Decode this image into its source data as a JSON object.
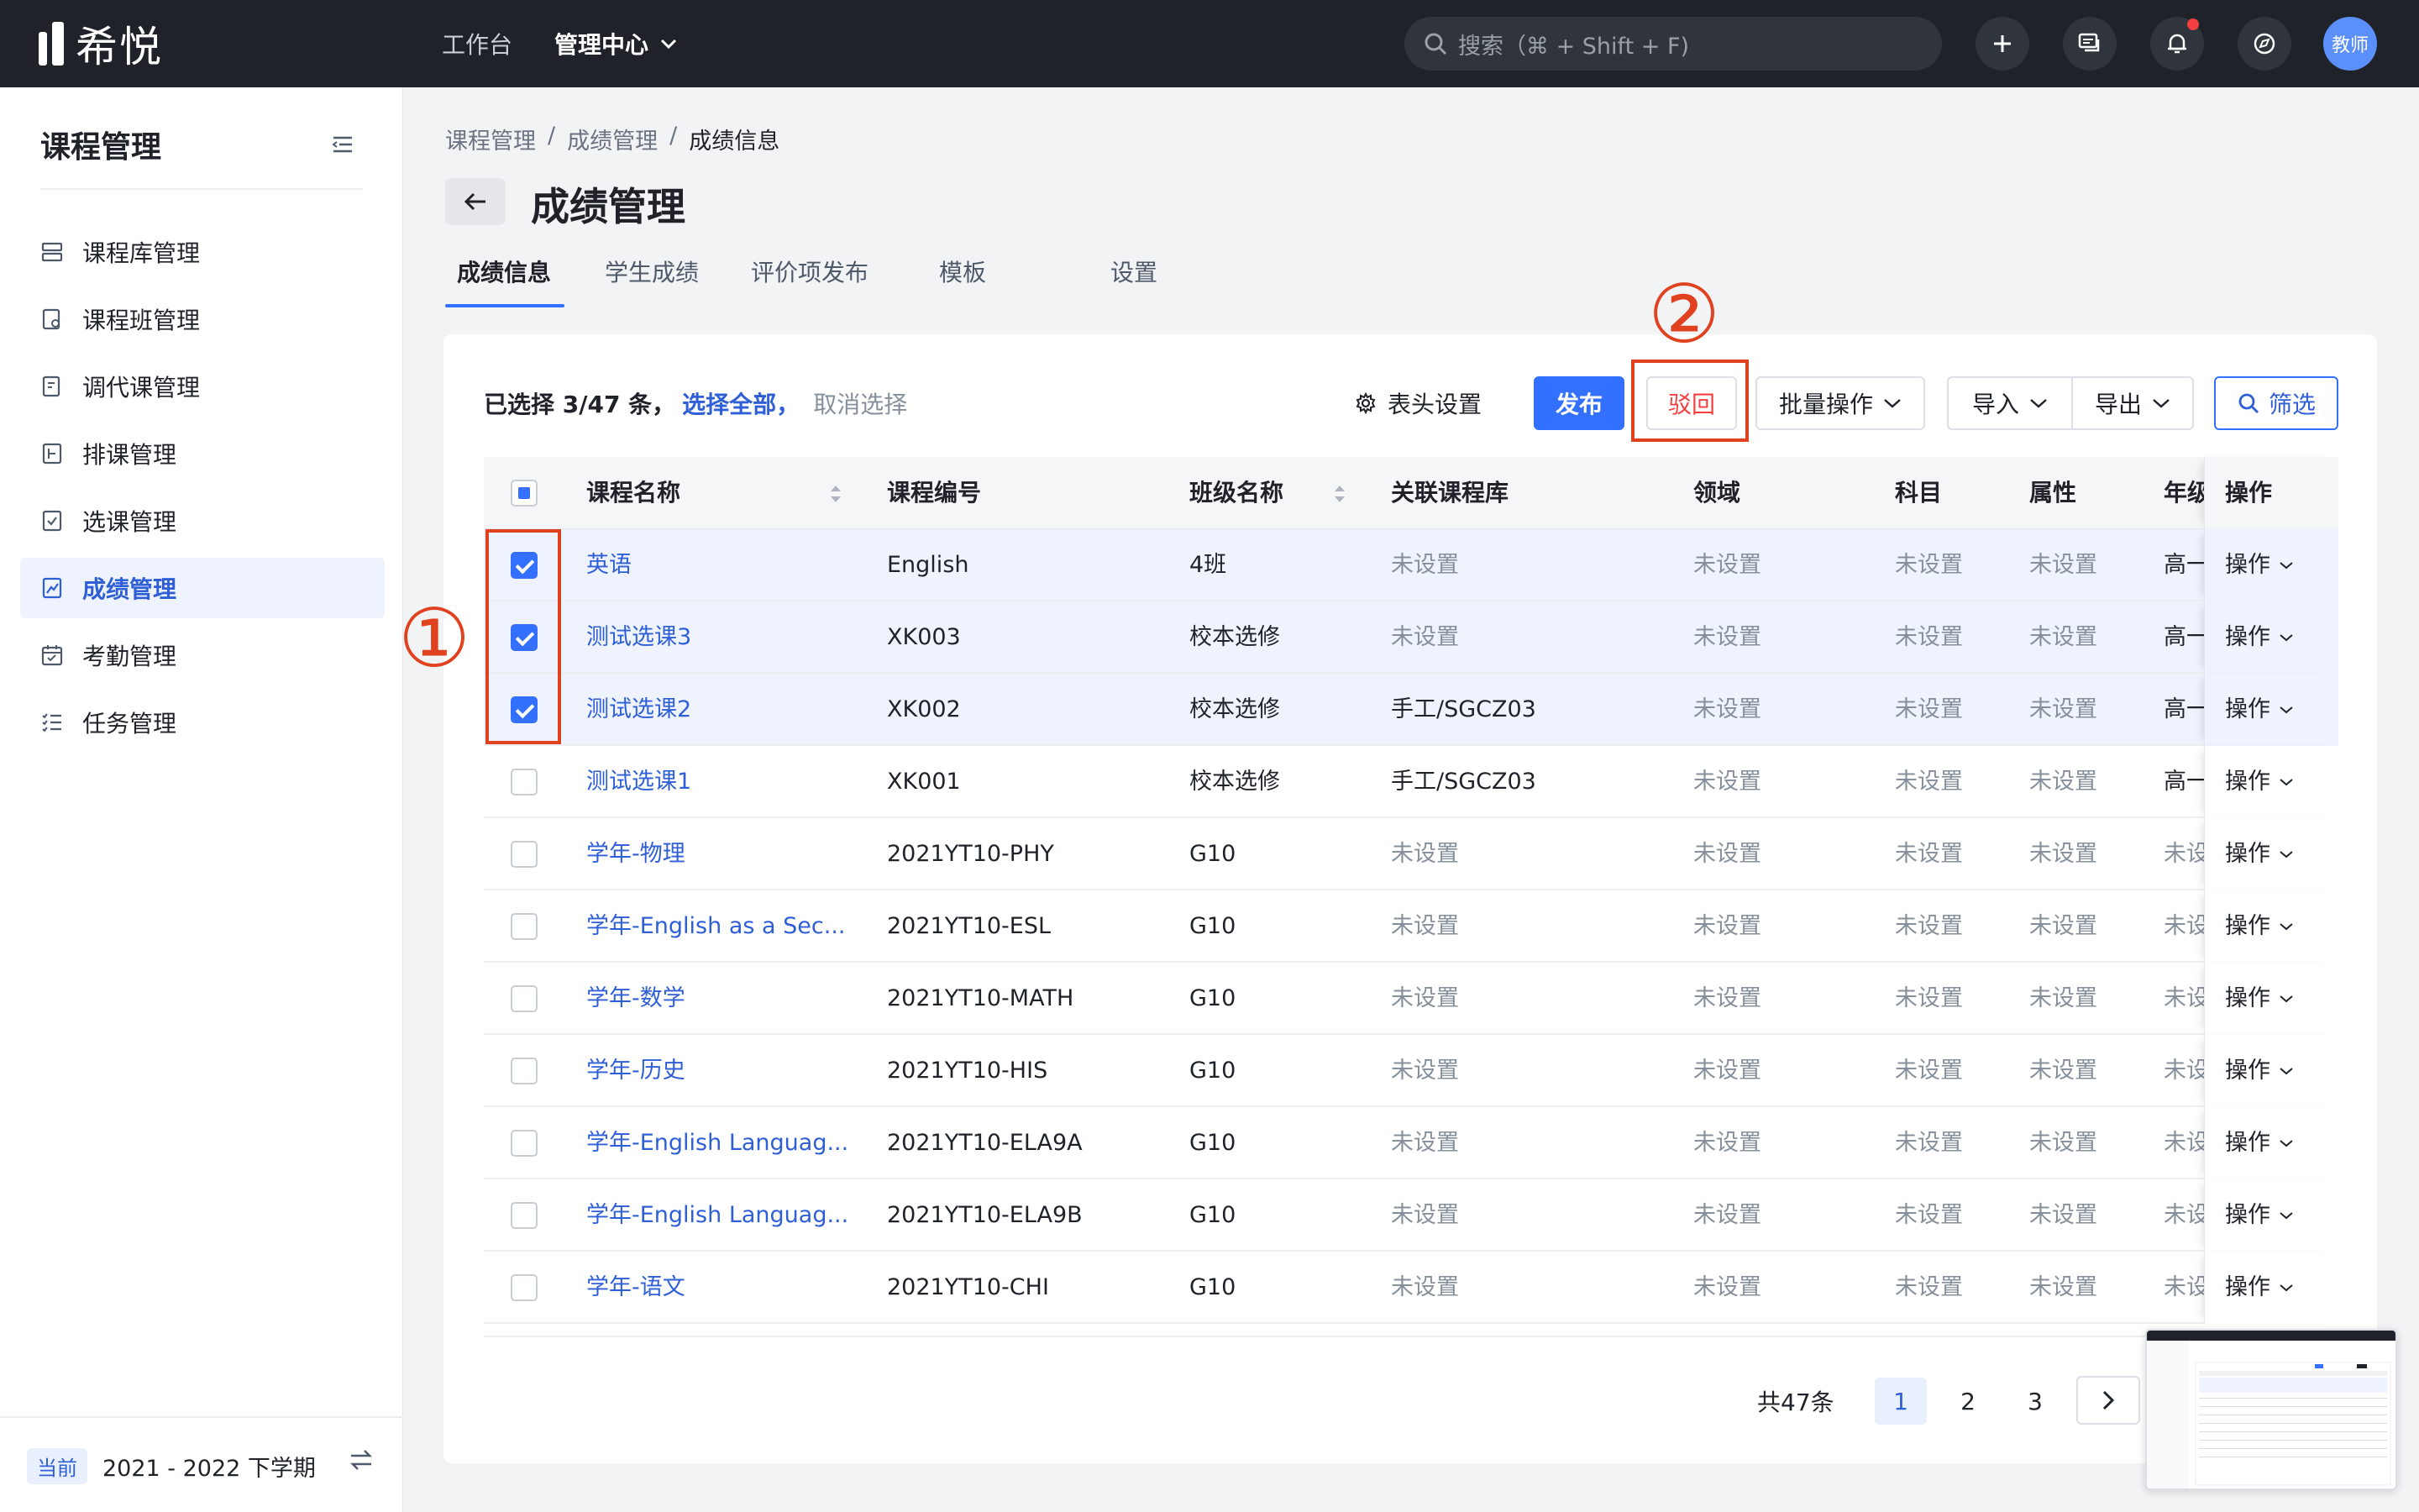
{
  "topbar": {
    "logo_text": "希悦",
    "nav": [
      {
        "label": "工作台"
      },
      {
        "label": "管理中心"
      }
    ],
    "search_placeholder": "搜索（⌘ + Shift + F)",
    "avatar_label": "教师"
  },
  "sidebar": {
    "title": "课程管理",
    "items": [
      {
        "label": "课程库管理"
      },
      {
        "label": "课程班管理"
      },
      {
        "label": "调代课管理"
      },
      {
        "label": "排课管理"
      },
      {
        "label": "选课管理"
      },
      {
        "label": "成绩管理"
      },
      {
        "label": "考勤管理"
      },
      {
        "label": "任务管理"
      }
    ],
    "footer_badge": "当前",
    "footer_term": "2021 - 2022 下学期"
  },
  "breadcrumb": [
    "课程管理",
    "/",
    "成绩管理",
    "/",
    "成绩信息"
  ],
  "page_title": "成绩管理",
  "tabs": [
    {
      "label": "成绩信息"
    },
    {
      "label": "学生成绩"
    },
    {
      "label": "评价项发布"
    },
    {
      "label": "模板"
    },
    {
      "label": "设置"
    }
  ],
  "toolbar": {
    "selection": "已选择 3/47 条，",
    "select_all": "选择全部，",
    "cancel_select": "取消选择",
    "header_settings": "表头设置",
    "publish": "发布",
    "reject": "驳回",
    "batch": "批量操作",
    "import": "导入",
    "export": "导出",
    "filter": "筛选"
  },
  "annotations": {
    "one": "①",
    "two": "②"
  },
  "table": {
    "columns": [
      "课程名称",
      "课程编号",
      "班级名称",
      "关联课程库",
      "领域",
      "科目",
      "属性",
      "年级",
      "操作"
    ],
    "op_label": "操作",
    "rows": [
      {
        "name": "英语",
        "code": "English",
        "cls": "4班",
        "lib": "未设置",
        "domain": "未设置",
        "subject": "未设置",
        "attr": "未设置",
        "grade": "高一",
        "checked": true
      },
      {
        "name": "测试选课3",
        "code": "XK003",
        "cls": "校本选修",
        "lib": "未设置",
        "domain": "未设置",
        "subject": "未设置",
        "attr": "未设置",
        "grade": "高一",
        "checked": true
      },
      {
        "name": "测试选课2",
        "code": "XK002",
        "cls": "校本选修",
        "lib": "手工/SGCZ03",
        "domain": "未设置",
        "subject": "未设置",
        "attr": "未设置",
        "grade": "高一",
        "checked": true
      },
      {
        "name": "测试选课1",
        "code": "XK001",
        "cls": "校本选修",
        "lib": "手工/SGCZ03",
        "domain": "未设置",
        "subject": "未设置",
        "attr": "未设置",
        "grade": "高一",
        "checked": false
      },
      {
        "name": "学年-物理",
        "code": "2021YT10-PHY",
        "cls": "G10",
        "lib": "未设置",
        "domain": "未设置",
        "subject": "未设置",
        "attr": "未设置",
        "grade": "未设",
        "checked": false
      },
      {
        "name": "学年-English as a Sec...",
        "code": "2021YT10-ESL",
        "cls": "G10",
        "lib": "未设置",
        "domain": "未设置",
        "subject": "未设置",
        "attr": "未设置",
        "grade": "未设",
        "checked": false
      },
      {
        "name": "学年-数学",
        "code": "2021YT10-MATH",
        "cls": "G10",
        "lib": "未设置",
        "domain": "未设置",
        "subject": "未设置",
        "attr": "未设置",
        "grade": "未设",
        "checked": false
      },
      {
        "name": "学年-历史",
        "code": "2021YT10-HIS",
        "cls": "G10",
        "lib": "未设置",
        "domain": "未设置",
        "subject": "未设置",
        "attr": "未设置",
        "grade": "未设",
        "checked": false
      },
      {
        "name": "学年-English Languag...",
        "code": "2021YT10-ELA9A",
        "cls": "G10",
        "lib": "未设置",
        "domain": "未设置",
        "subject": "未设置",
        "attr": "未设置",
        "grade": "未设",
        "checked": false
      },
      {
        "name": "学年-English Languag...",
        "code": "2021YT10-ELA9B",
        "cls": "G10",
        "lib": "未设置",
        "domain": "未设置",
        "subject": "未设置",
        "attr": "未设置",
        "grade": "未设",
        "checked": false
      },
      {
        "name": "学年-语文",
        "code": "2021YT10-CHI",
        "cls": "G10",
        "lib": "未设置",
        "domain": "未设置",
        "subject": "未设置",
        "attr": "未设置",
        "grade": "未设",
        "checked": false
      }
    ]
  },
  "pagination": {
    "total": "共47条",
    "pages": [
      "1",
      "2",
      "3"
    ],
    "current": "1"
  },
  "colors": {
    "accent": "#3370ff",
    "annotation": "#e0421f",
    "topbar": "#1f2229"
  }
}
